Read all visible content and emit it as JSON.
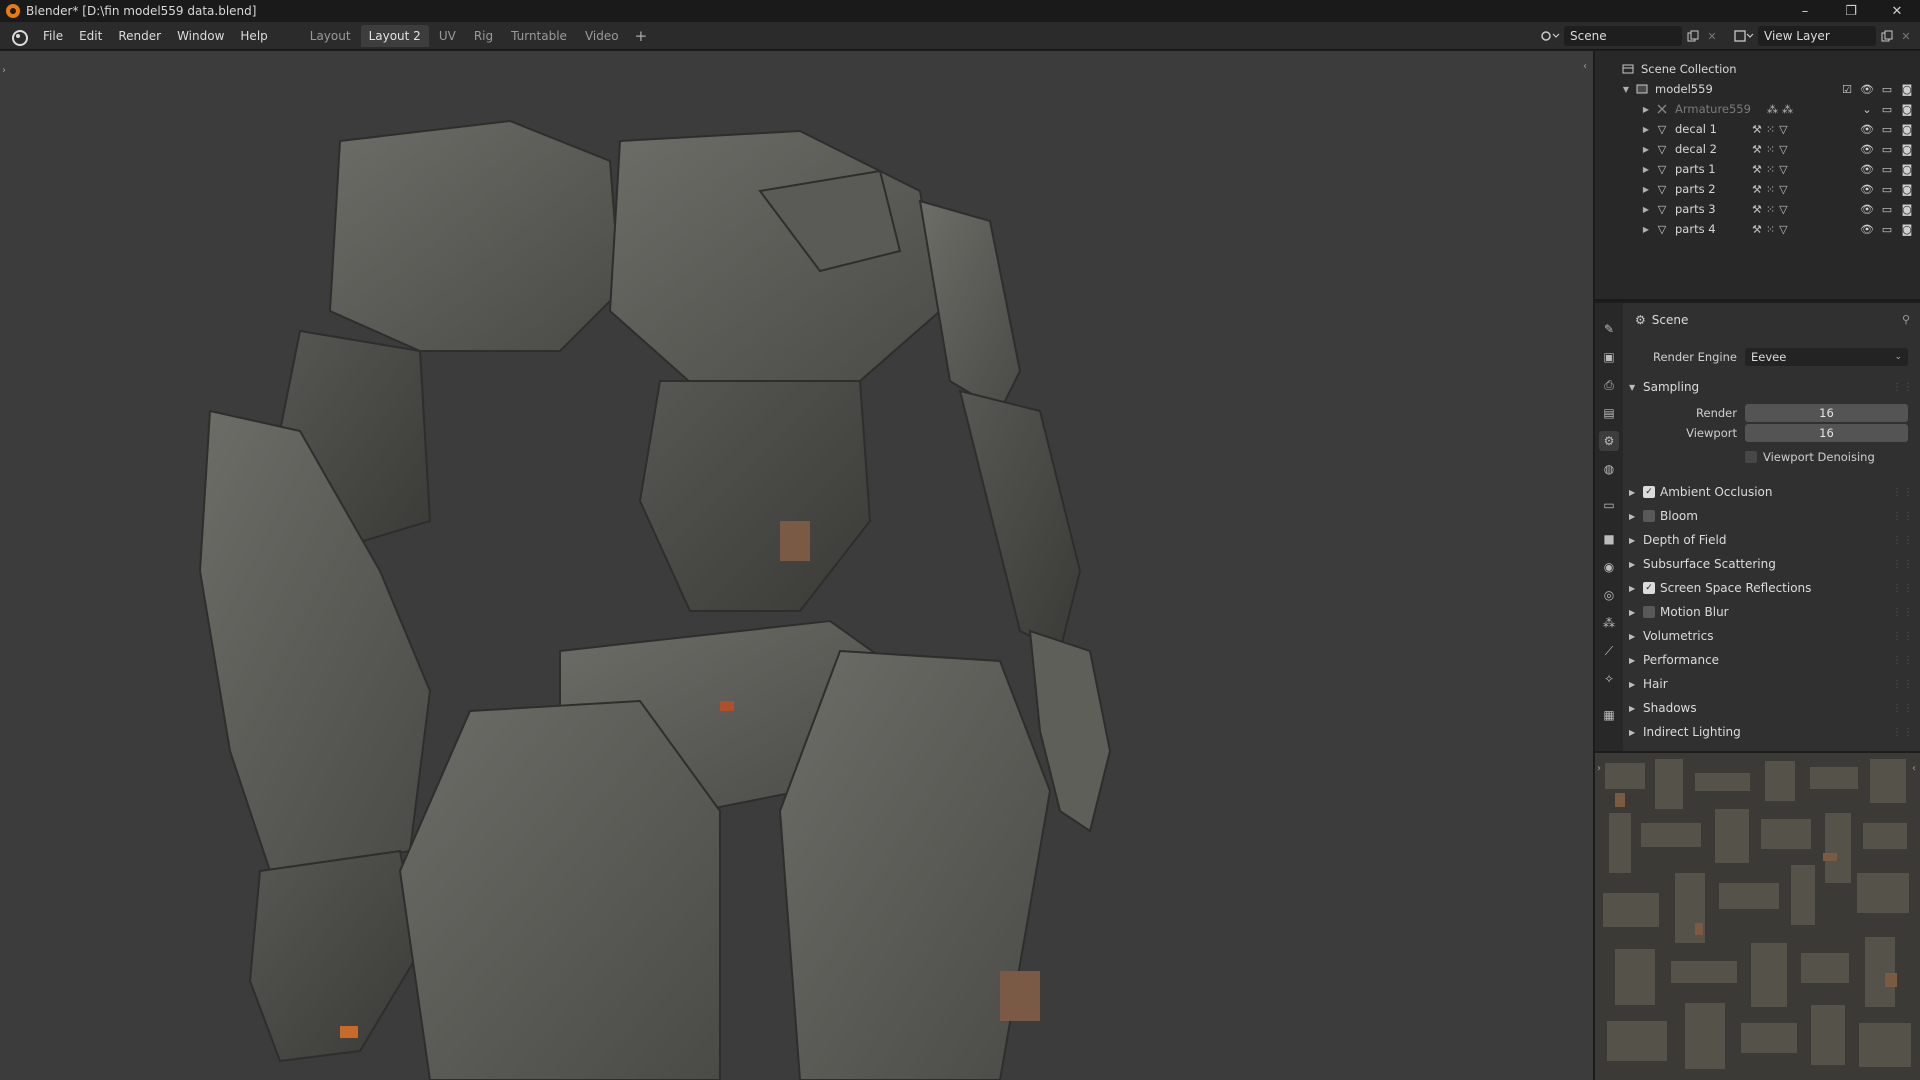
{
  "window": {
    "title": "Blender* [D:\\fin model559 data.blend]",
    "controls": [
      "–",
      "❐",
      "✕"
    ]
  },
  "menu": [
    "File",
    "Edit",
    "Render",
    "Window",
    "Help"
  ],
  "workspaces": [
    {
      "label": "Layout",
      "active": false
    },
    {
      "label": "Layout 2",
      "active": true
    },
    {
      "label": "UV",
      "active": false
    },
    {
      "label": "Rig",
      "active": false
    },
    {
      "label": "Turntable",
      "active": false
    },
    {
      "label": "Video",
      "active": false
    }
  ],
  "header": {
    "scene_name": "Scene",
    "view_layer": "View Layer"
  },
  "outliner": {
    "root": "Scene Collection",
    "collection": "model559",
    "items": [
      {
        "label": "Armature559",
        "icon": "armature-icon",
        "dim": true
      },
      {
        "label": "decal 1",
        "icon": "mesh-icon",
        "dim": false
      },
      {
        "label": "decal 2",
        "icon": "mesh-icon",
        "dim": false
      },
      {
        "label": "parts 1",
        "icon": "mesh-icon",
        "dim": false
      },
      {
        "label": "parts 2",
        "icon": "mesh-icon",
        "dim": false
      },
      {
        "label": "parts 3",
        "icon": "mesh-icon",
        "dim": false
      },
      {
        "label": "parts 4",
        "icon": "mesh-icon",
        "dim": false
      }
    ]
  },
  "properties": {
    "context_title": "Scene",
    "render_engine_label": "Render Engine",
    "render_engine_value": "Eevee",
    "sampling": {
      "title": "Sampling",
      "render_label": "Render",
      "render_value": "16",
      "viewport_label": "Viewport",
      "viewport_value": "16",
      "denoise_label": "Viewport Denoising",
      "denoise_checked": false
    },
    "panels": [
      {
        "label": "Ambient Occlusion",
        "checkbox": true,
        "checked": true
      },
      {
        "label": "Bloom",
        "checkbox": true,
        "checked": false
      },
      {
        "label": "Depth of Field",
        "checkbox": false,
        "checked": false
      },
      {
        "label": "Subsurface Scattering",
        "checkbox": false,
        "checked": false
      },
      {
        "label": "Screen Space Reflections",
        "checkbox": true,
        "checked": true
      },
      {
        "label": "Motion Blur",
        "checkbox": true,
        "checked": false
      },
      {
        "label": "Volumetrics",
        "checkbox": false,
        "checked": false
      },
      {
        "label": "Performance",
        "checkbox": false,
        "checked": false
      },
      {
        "label": "Hair",
        "checkbox": false,
        "checked": false
      },
      {
        "label": "Shadows",
        "checkbox": false,
        "checked": false
      },
      {
        "label": "Indirect Lighting",
        "checkbox": false,
        "checked": false
      }
    ]
  },
  "colors": {
    "accent": "#e87d0d",
    "viewport_bg": "#3c3c3c",
    "panel_bg": "#303030"
  }
}
